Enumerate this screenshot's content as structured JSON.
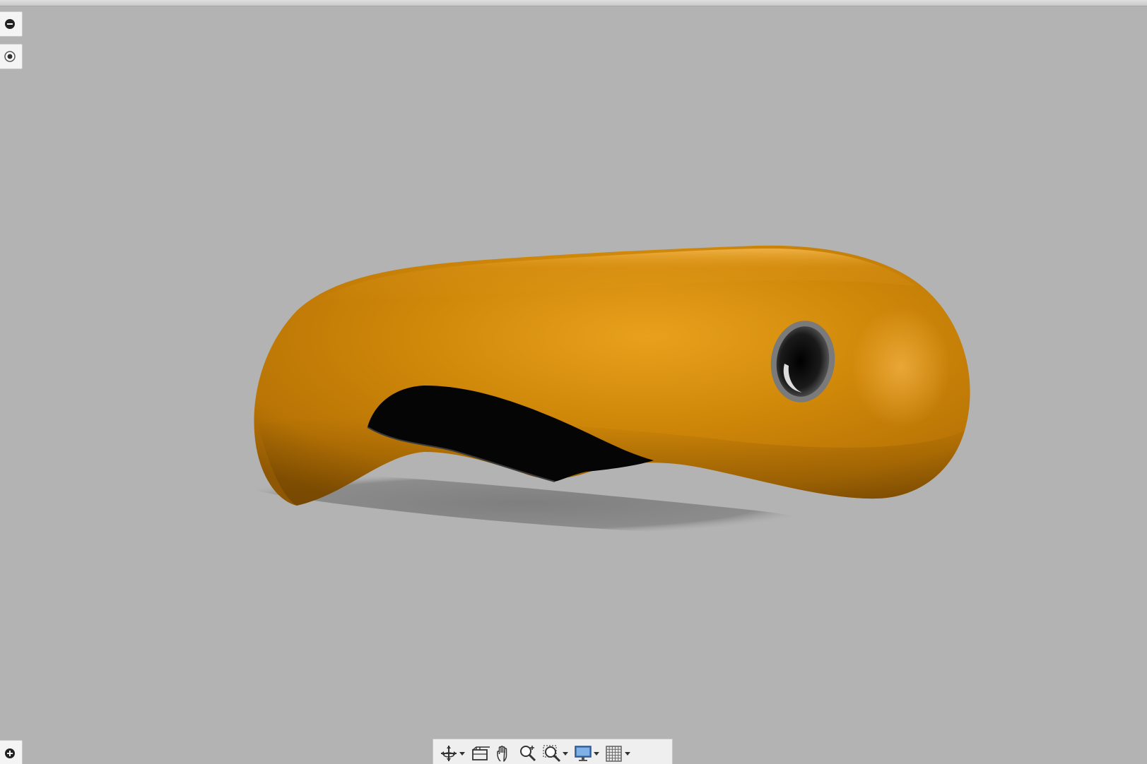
{
  "app": {
    "background_color": "#b3b3b3"
  },
  "side_controls": [
    {
      "id": "collapse",
      "icon": "minus-circle-icon"
    },
    {
      "id": "radio",
      "icon": "radio-dot-icon"
    },
    {
      "id": "expand",
      "icon": "plus-circle-icon"
    }
  ],
  "model": {
    "body_color": "#d08a0a",
    "slot_color": "#050505",
    "hole_color": "#2a2a2a",
    "shadow_color": "#8e8e8e"
  },
  "navigation_bar": {
    "tools": [
      {
        "id": "orbit",
        "icon": "orbit-icon",
        "has_dropdown": true
      },
      {
        "id": "look-at",
        "icon": "look-at-icon",
        "has_dropdown": false
      },
      {
        "id": "pan",
        "icon": "pan-hand-icon",
        "has_dropdown": false
      },
      {
        "id": "zoom",
        "icon": "zoom-icon",
        "has_dropdown": false
      },
      {
        "id": "fit",
        "icon": "zoom-window-icon",
        "has_dropdown": true
      },
      {
        "id": "display",
        "icon": "display-settings-icon",
        "has_dropdown": true
      },
      {
        "id": "grid",
        "icon": "grid-snap-icon",
        "has_dropdown": true
      }
    ]
  }
}
